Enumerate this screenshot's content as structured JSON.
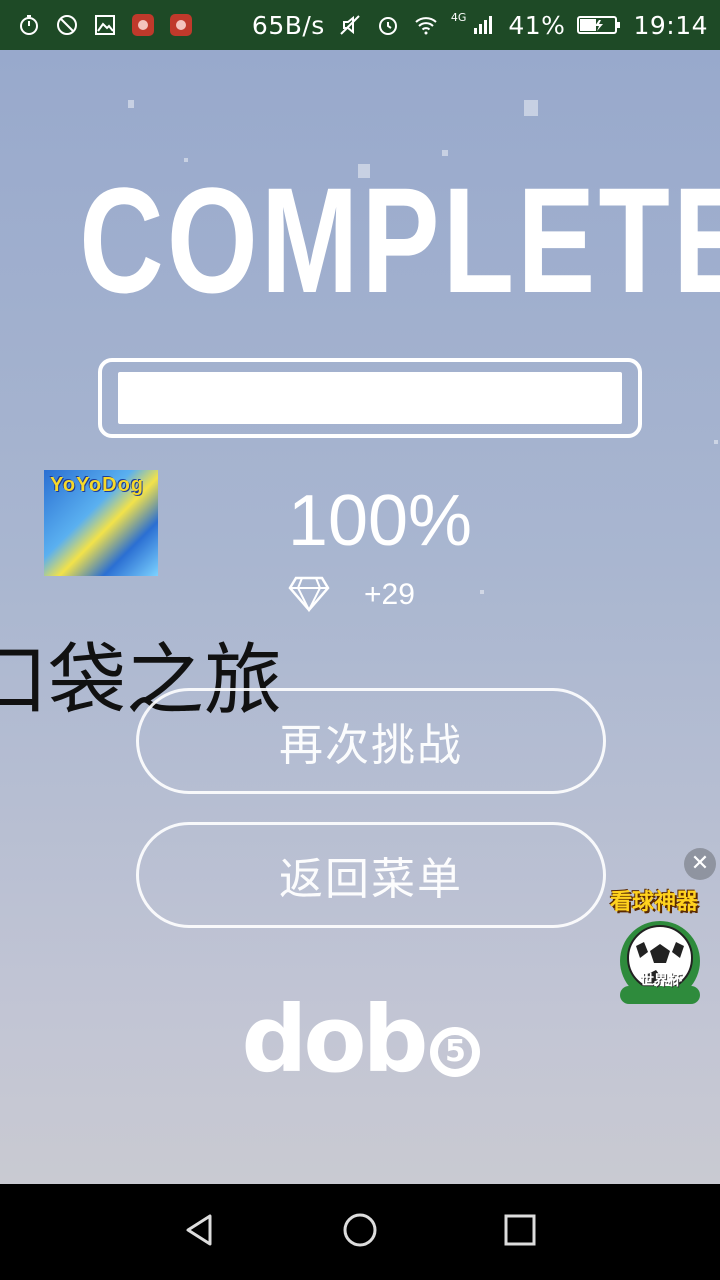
{
  "status_bar": {
    "net_speed": "65B/s",
    "signal_label": "4G",
    "battery": "41%",
    "time": "19:14",
    "background": "#1e4a26"
  },
  "game": {
    "title": "COMPLETE",
    "progress": 1.0,
    "percent_text": "100%",
    "gem_count": "+29",
    "overlay_title": "口袋之旅",
    "badge_label": "YoYoDog",
    "retry_label": "再次挑战",
    "menu_label": "返回菜单",
    "logo_text": "dob",
    "logo_digit": "5"
  },
  "ad": {
    "banner_text": "看球神器",
    "ball_label": "世界杯",
    "close_symbol": "✕"
  },
  "icons": {
    "status_left": [
      "timer-icon",
      "blocked-icon",
      "image-icon",
      "huawei-icon",
      "huawei-icon"
    ],
    "status_right": [
      "mute-icon",
      "alarm-icon",
      "wifi-icon",
      "signal-icon",
      "battery-icon"
    ],
    "nav": [
      "back-icon",
      "home-icon",
      "recents-icon"
    ]
  }
}
